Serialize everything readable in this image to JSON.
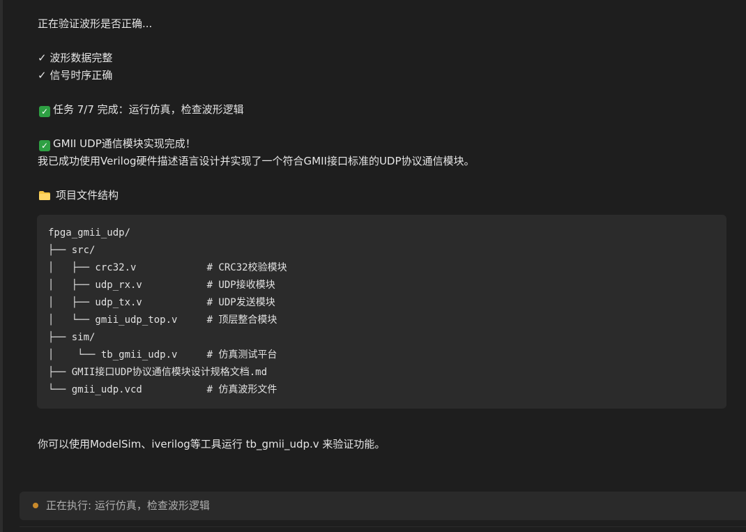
{
  "messages": {
    "verifying": "正在验证波形是否正确...",
    "check1": "✓ 波形数据完整",
    "check2": "✓ 信号时序正确",
    "task_done": "任务 7/7 完成：运行仿真，检查波形逻辑",
    "module_done": "GMII UDP通信模块实现完成！",
    "summary": "我已成功使用Verilog硬件描述语言设计并实现了一个符合GMII接口标准的UDP协议通信模块。",
    "structure_heading": "项目文件结构",
    "usage": "你可以使用ModelSim、iverilog等工具运行 tb_gmii_udp.v 来验证功能。"
  },
  "icons": {
    "check": "white-check-mark-icon",
    "folder": "folder-icon",
    "status": "status-dot-icon"
  },
  "file_tree": [
    "fpga_gmii_udp/",
    "├── src/",
    "│   ├── crc32.v            # CRC32校验模块",
    "│   ├── udp_rx.v           # UDP接收模块",
    "│   ├── udp_tx.v           # UDP发送模块",
    "│   └── gmii_udp_top.v     # 顶层整合模块",
    "├── sim/",
    "│    └── tb_gmii_udp.v     # 仿真测试平台",
    "├── GMII接口UDP协议通信模块设计规格文档.md",
    "└── gmii_udp.vcd           # 仿真波形文件"
  ],
  "status": {
    "text": "正在执行: 运行仿真，检查波形逻辑"
  },
  "colors": {
    "background": "#1e1e1e",
    "code_background": "#2b2b2b",
    "check_green": "#2ea043",
    "status_dot": "#c98a2b",
    "folder_yellow": "#f4c542"
  }
}
